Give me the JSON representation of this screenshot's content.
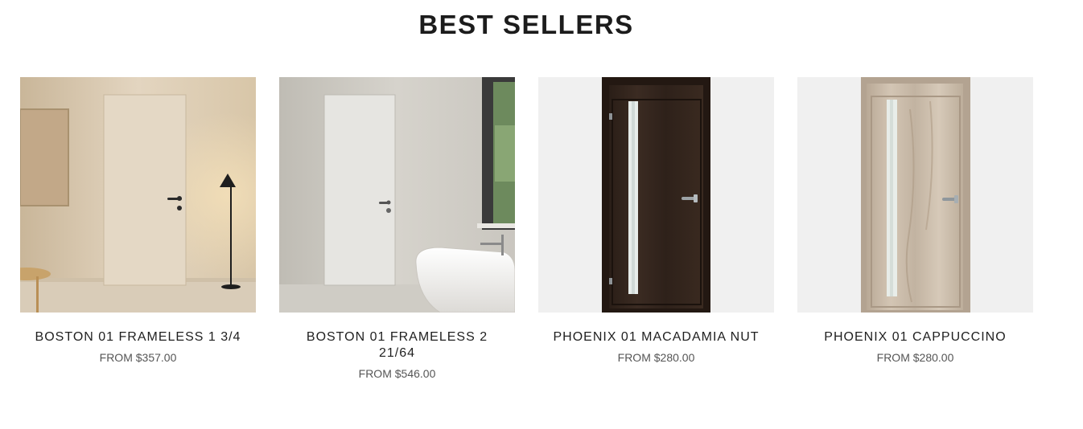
{
  "section": {
    "title": "BEST SELLERS"
  },
  "products": [
    {
      "name": "BOSTON 01 FRAMELESS 1 3/4",
      "price": "FROM $357.00"
    },
    {
      "name": "BOSTON 01 FRAMELESS 2 21/64",
      "price": "FROM $546.00"
    },
    {
      "name": "PHOENIX 01 MACADAMIA NUT",
      "price": "FROM $280.00"
    },
    {
      "name": "PHOENIX 01 CAPPUCCINO",
      "price": "FROM $280.00"
    }
  ],
  "colors": {
    "title": "#1c1c1c",
    "name": "#1f1f1f",
    "price": "#555555",
    "image_bg": "#f0f0f0"
  }
}
